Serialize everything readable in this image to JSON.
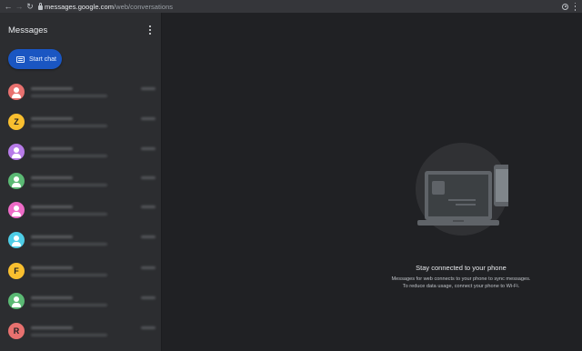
{
  "browser": {
    "url_host": "messages.google.com",
    "url_path": "/web/conversations",
    "icons": [
      "back-icon",
      "forward-icon",
      "reload-icon",
      "lock-icon",
      "location-icon",
      "browser-menu-icon"
    ]
  },
  "sidebar": {
    "title": "Messages",
    "start_chat_label": "Start chat",
    "conversations": [
      {
        "avatar_type": "person",
        "letter": "",
        "color": "#e8716f"
      },
      {
        "avatar_type": "letter",
        "letter": "Z",
        "color": "#f9bf2f"
      },
      {
        "avatar_type": "person",
        "letter": "",
        "color": "#b77be8"
      },
      {
        "avatar_type": "person",
        "letter": "",
        "color": "#5bb974"
      },
      {
        "avatar_type": "person",
        "letter": "",
        "color": "#ee6bc7"
      },
      {
        "avatar_type": "person",
        "letter": "",
        "color": "#4ecde6"
      },
      {
        "avatar_type": "letter",
        "letter": "F",
        "color": "#f9bf2f"
      },
      {
        "avatar_type": "person",
        "letter": "",
        "color": "#5bb974"
      },
      {
        "avatar_type": "letter",
        "letter": "R",
        "color": "#e8716f"
      }
    ]
  },
  "main": {
    "title": "Stay connected to your phone",
    "description_line1": "Messages for web connects to your phone to sync messages.",
    "description_line2": "To reduce data usage, connect your phone to Wi-Fi."
  },
  "colors": {
    "accent": "#1a56c2",
    "background": "#202124",
    "sidebar": "#2c2d30"
  }
}
